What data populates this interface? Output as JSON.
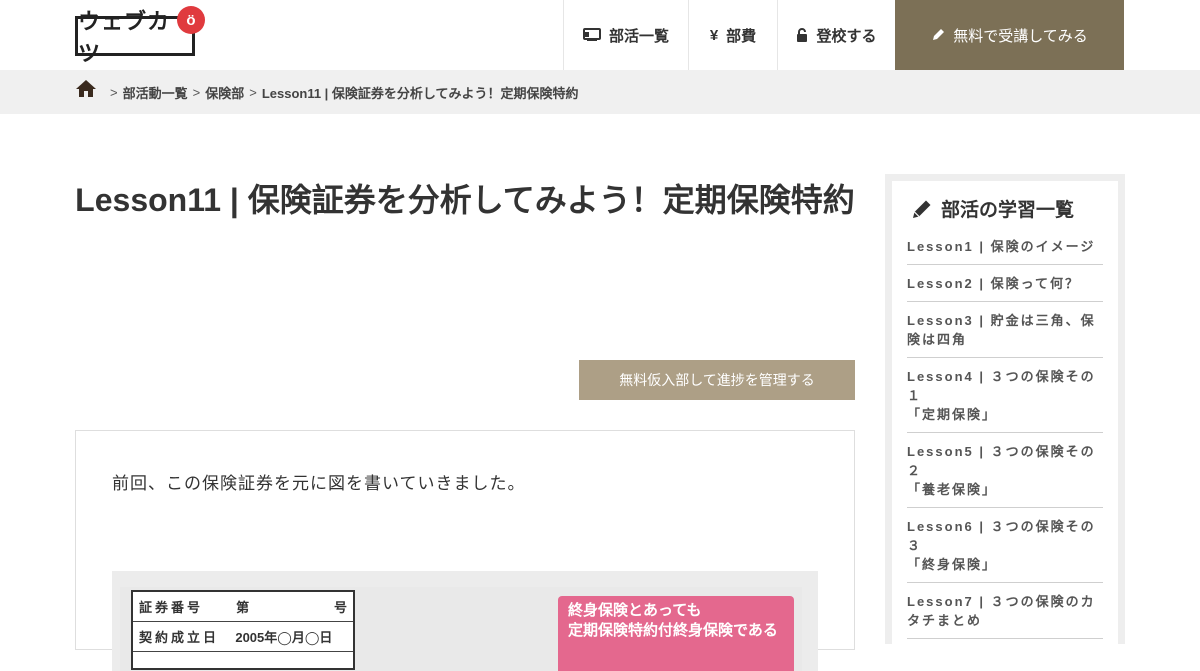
{
  "header": {
    "logo_text": "ウェブカツ",
    "logo_badge": "ö",
    "nav": [
      {
        "label": "部活一覧",
        "icon": "list-board-icon"
      },
      {
        "label": "部費",
        "icon": "yen-icon"
      },
      {
        "label": "登校する",
        "icon": "unlock-icon"
      },
      {
        "label": "無料で受講してみる",
        "icon": "pencil-icon"
      }
    ],
    "colors": {
      "cta_bg": "#7c7056",
      "accent_red": "#e03a3e"
    }
  },
  "breadcrumb": {
    "home_icon": "home-icon",
    "items": [
      "部活動一覧",
      "保険部",
      "Lesson11 | 保険証券を分析してみよう！定期保険特約"
    ],
    "separator": ">"
  },
  "main": {
    "title": "Lesson11 | 保険証券を分析してみよう！定期保険特約",
    "progress_button": "無料仮入部して進捗を管理する",
    "intro": "前回、この保険証券を元に図を書いていきました。",
    "figure": {
      "table_rows": [
        {
          "c1": "証券番号",
          "c2": "第",
          "c3": "号"
        },
        {
          "c1": "契約成立日",
          "c2": "2005年◯月◯日",
          "c3": ""
        }
      ],
      "callout_lines": [
        "終身保険とあっても",
        "定期保険特約付終身保険である"
      ]
    }
  },
  "sidebar": {
    "heading": "部活の学習一覧",
    "lessons": [
      "Lesson1 | 保険のイメージ",
      "Lesson2 | 保険って何？",
      "Lesson3 | 貯金は三角、保険は四角",
      "Lesson4 | ３つの保険その１\n「定期保険」",
      "Lesson5 | ３つの保険その２\n「養老保険」",
      "Lesson6 | ３つの保険その３\n「終身保険」",
      "Lesson7 | ３つの保険のカタチまとめ"
    ]
  }
}
